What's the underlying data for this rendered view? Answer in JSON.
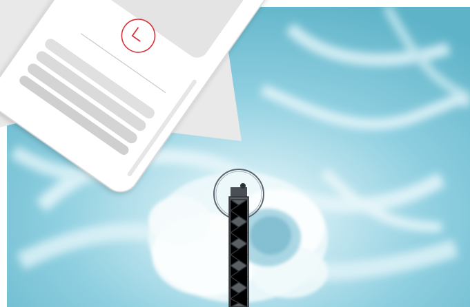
{
  "scene": {
    "colors": {
      "water_light": "#d4eef4",
      "water_mid": "#9fd4e2",
      "water_deep": "#5fb3c8",
      "foam": "#f4fbfd",
      "phone_body": "#ffffff",
      "phone_outline": "#d8d8d8",
      "card_grey": "#e4e4e4",
      "accent_red": "#d9323a",
      "tower_steel": "#4a4f55"
    },
    "icons": {
      "phone_badge": "clock-icon"
    }
  }
}
